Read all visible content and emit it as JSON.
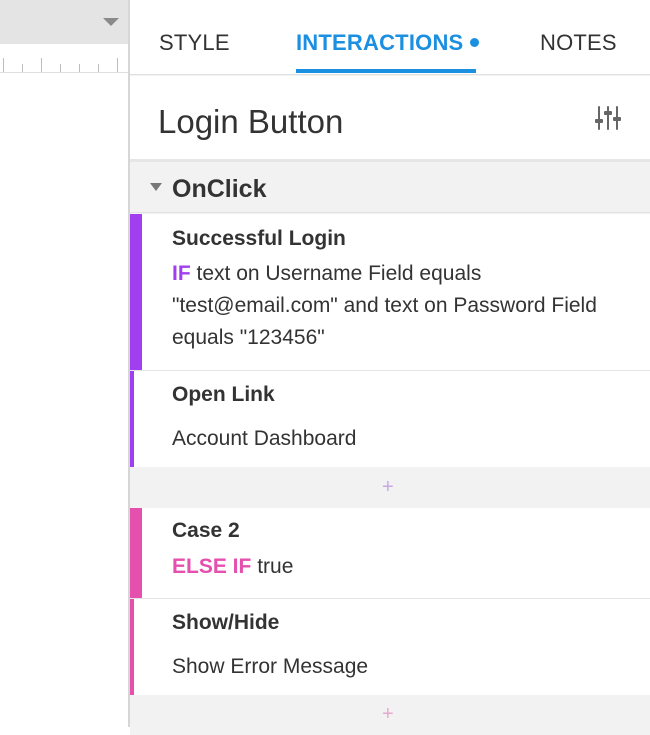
{
  "tabs": {
    "style": "STYLE",
    "interactions": "INTERACTIONS",
    "notes": "NOTES"
  },
  "widget": {
    "title": "Login Button",
    "settings_icon": "sliders-icon"
  },
  "event": {
    "name": "OnClick"
  },
  "cases": [
    {
      "name": "Successful Login",
      "keyword": "IF",
      "condition": " text on Username Field equals \"test@email.com\" and text on Password Field equals \"123456\"",
      "color": "#a13ff0",
      "action": {
        "name": "Open Link",
        "target": "Account Dashboard"
      }
    },
    {
      "name": "Case 2",
      "keyword": "ELSE IF",
      "condition": " true",
      "color": "#e54fae",
      "action": {
        "name": "Show/Hide",
        "target": "Show Error Message"
      }
    }
  ],
  "add_symbol": "+",
  "colors": {
    "accent": "#1b8fe0",
    "case1": "#a13ff0",
    "case2": "#e54fae"
  }
}
